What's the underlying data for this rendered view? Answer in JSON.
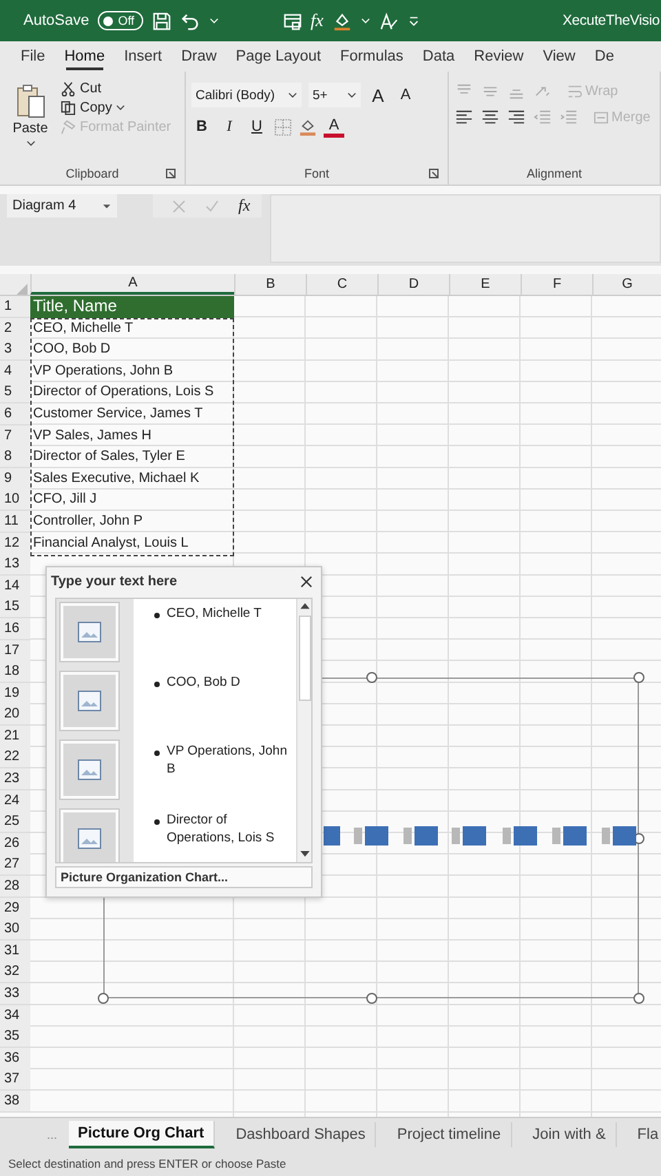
{
  "title_bar": {
    "autosave_label": "AutoSave",
    "autosave_toggle": {
      "label": "Off",
      "on": false
    },
    "fx_label": "fx",
    "document_title": "XecuteTheVisio"
  },
  "ribbon_tabs": [
    {
      "label": "File",
      "selected": false
    },
    {
      "label": "Home",
      "selected": true
    },
    {
      "label": "Insert",
      "selected": false
    },
    {
      "label": "Draw",
      "selected": false
    },
    {
      "label": "Page Layout",
      "selected": false
    },
    {
      "label": "Formulas",
      "selected": false
    },
    {
      "label": "Data",
      "selected": false
    },
    {
      "label": "Review",
      "selected": false
    },
    {
      "label": "View",
      "selected": false
    },
    {
      "label": "De",
      "selected": false
    }
  ],
  "ribbon": {
    "clipboard": {
      "paste": "Paste",
      "cut": "Cut",
      "copy": "Copy",
      "format_painter": {
        "label": "Format Painter",
        "disabled": true
      },
      "group_label": "Clipboard"
    },
    "font": {
      "font_name": "Calibri (Body)",
      "font_size": "5+",
      "grow": "A",
      "shrink": "A",
      "bold": "B",
      "italic": "I",
      "underline": "U",
      "font_color": "A",
      "group_label": "Font"
    },
    "alignment": {
      "wrap": {
        "label": "Wrap",
        "disabled": true
      },
      "merge": {
        "label": "Merge",
        "disabled": true
      },
      "group_label": "Alignment"
    }
  },
  "formula_bar": {
    "name_box": "Diagram 4",
    "fx_label": "fx"
  },
  "sheet": {
    "columns": [
      "A",
      "B",
      "C",
      "D",
      "E",
      "F",
      "G"
    ],
    "row_numbers": [
      "1",
      "2",
      "3",
      "4",
      "5",
      "6",
      "7",
      "8",
      "9",
      "10",
      "11",
      "12",
      "13",
      "14",
      "15",
      "16",
      "17",
      "18",
      "19",
      "20",
      "21",
      "22",
      "23",
      "24",
      "25",
      "26",
      "27",
      "28",
      "29",
      "30",
      "31",
      "32",
      "33",
      "34",
      "35",
      "36",
      "37",
      "38"
    ],
    "column_a": [
      "Title, Name",
      "CEO, Michelle T",
      "COO, Bob D",
      "VP Operations, John B",
      "Director of Operations, Lois S",
      "Customer Service, James T",
      "VP Sales, James H",
      "Director of Sales, Tyler E",
      "Sales Executive, Michael K",
      "CFO, Jill  J",
      "Controller, John P",
      "Financial Analyst, Louis L"
    ]
  },
  "text_pane": {
    "title": "Type your text here",
    "items": [
      "CEO, Michelle T",
      "COO, Bob D",
      "VP Operations, John B",
      "Director of Operations, Lois S"
    ],
    "footer": "Picture Organization Chart..."
  },
  "sheet_tabs": {
    "more": "...",
    "tabs": [
      {
        "label": "Picture Org Chart",
        "selected": true
      },
      {
        "label": "Dashboard Shapes",
        "selected": false
      },
      {
        "label": "Project timeline",
        "selected": false
      },
      {
        "label": "Join with &",
        "selected": false
      },
      {
        "label": "Fla",
        "selected": false
      }
    ]
  },
  "status_bar": {
    "message": "Select destination and press ENTER or choose Paste"
  }
}
